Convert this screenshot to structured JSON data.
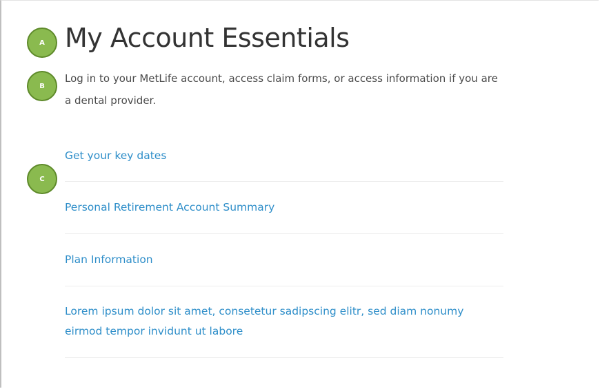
{
  "markers": {
    "a": "A",
    "b": "B",
    "c": "C"
  },
  "title": "My Account Essentials",
  "intro": "Log in to your MetLife account, access claim forms, or access information if you are a dental provider.",
  "links": [
    {
      "label": "Get your key dates"
    },
    {
      "label": "Personal Retirement Account Summary"
    },
    {
      "label": "Plan Information"
    },
    {
      "label": "Lorem ipsum dolor sit amet, consetetur sadipscing elitr, sed diam nonumy eirmod tempor invidunt ut labore"
    }
  ],
  "colors": {
    "marker_fill": "#8aba4f",
    "marker_border": "#5e8a2a",
    "link": "#2e8ec9",
    "title": "#333333"
  }
}
